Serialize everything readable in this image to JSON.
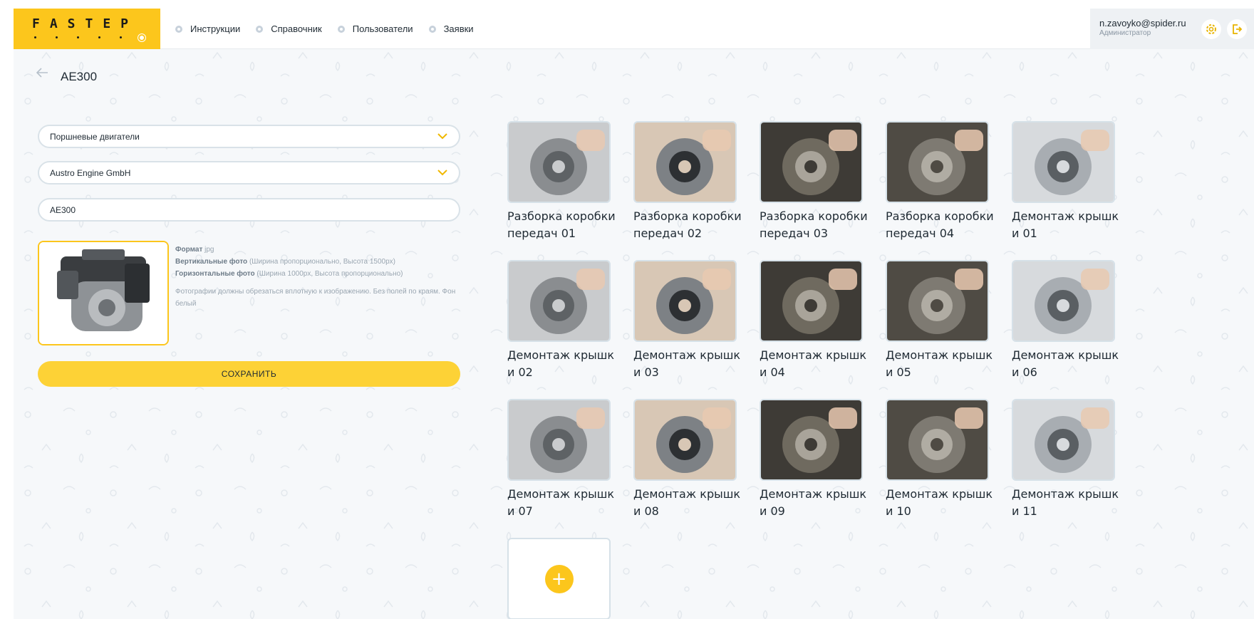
{
  "header": {
    "logo_text": "FASTEP",
    "nav": [
      {
        "label": "Инструкции"
      },
      {
        "label": "Справочник"
      },
      {
        "label": "Пользователи"
      },
      {
        "label": "Заявки"
      }
    ],
    "user_email": "n.zavoyko@spider.ru",
    "user_role": "Администратор"
  },
  "page": {
    "title": "AE300"
  },
  "form": {
    "category": "Поршневые двигатели",
    "manufacturer": "Austro Engine GmbH",
    "model": "AE300",
    "info": {
      "format_label": "Формат",
      "format_value": "jpg",
      "vertical_label": "Вертикальные фото",
      "vertical_value": "(Ширина пропорционально, Высота 1500px)",
      "horizontal_label": "Горизонтальные фото",
      "horizontal_value": "(Ширина 1000px, Высота пропорционально)",
      "note": "Фотографии должны обрезаться вплотную к изображению. Без полей по краям. Фон белый"
    },
    "save_label": "СОХРАНИТЬ"
  },
  "gallery": [
    {
      "caption": "Разборка коробки передач 01"
    },
    {
      "caption": "Разборка коробки передач 02"
    },
    {
      "caption": "Разборка коробки передач 03"
    },
    {
      "caption": "Разборка коробки передач 04"
    },
    {
      "caption": "Демонтаж крышки 01"
    },
    {
      "caption": "Демонтаж крышки 02"
    },
    {
      "caption": "Демонтаж крышки 03"
    },
    {
      "caption": "Демонтаж крышки 04"
    },
    {
      "caption": "Демонтаж крышки 05"
    },
    {
      "caption": "Демонтаж крышки 06"
    },
    {
      "caption": "Демонтаж крышки 07"
    },
    {
      "caption": "Демонтаж крышки 08"
    },
    {
      "caption": "Демонтаж крышки 09"
    },
    {
      "caption": "Демонтаж крышки 10"
    },
    {
      "caption": "Демонтаж крышки 11"
    },
    {
      "caption": ""
    }
  ],
  "icons": {
    "back": "arrow-left-icon",
    "settings": "gear-icon",
    "logout": "logout-icon",
    "dropdown": "chevron-down-icon",
    "add": "plus-icon"
  },
  "colors": {
    "accent": "#fcc61c",
    "button": "#fdd236",
    "background": "#f6f8fa"
  }
}
